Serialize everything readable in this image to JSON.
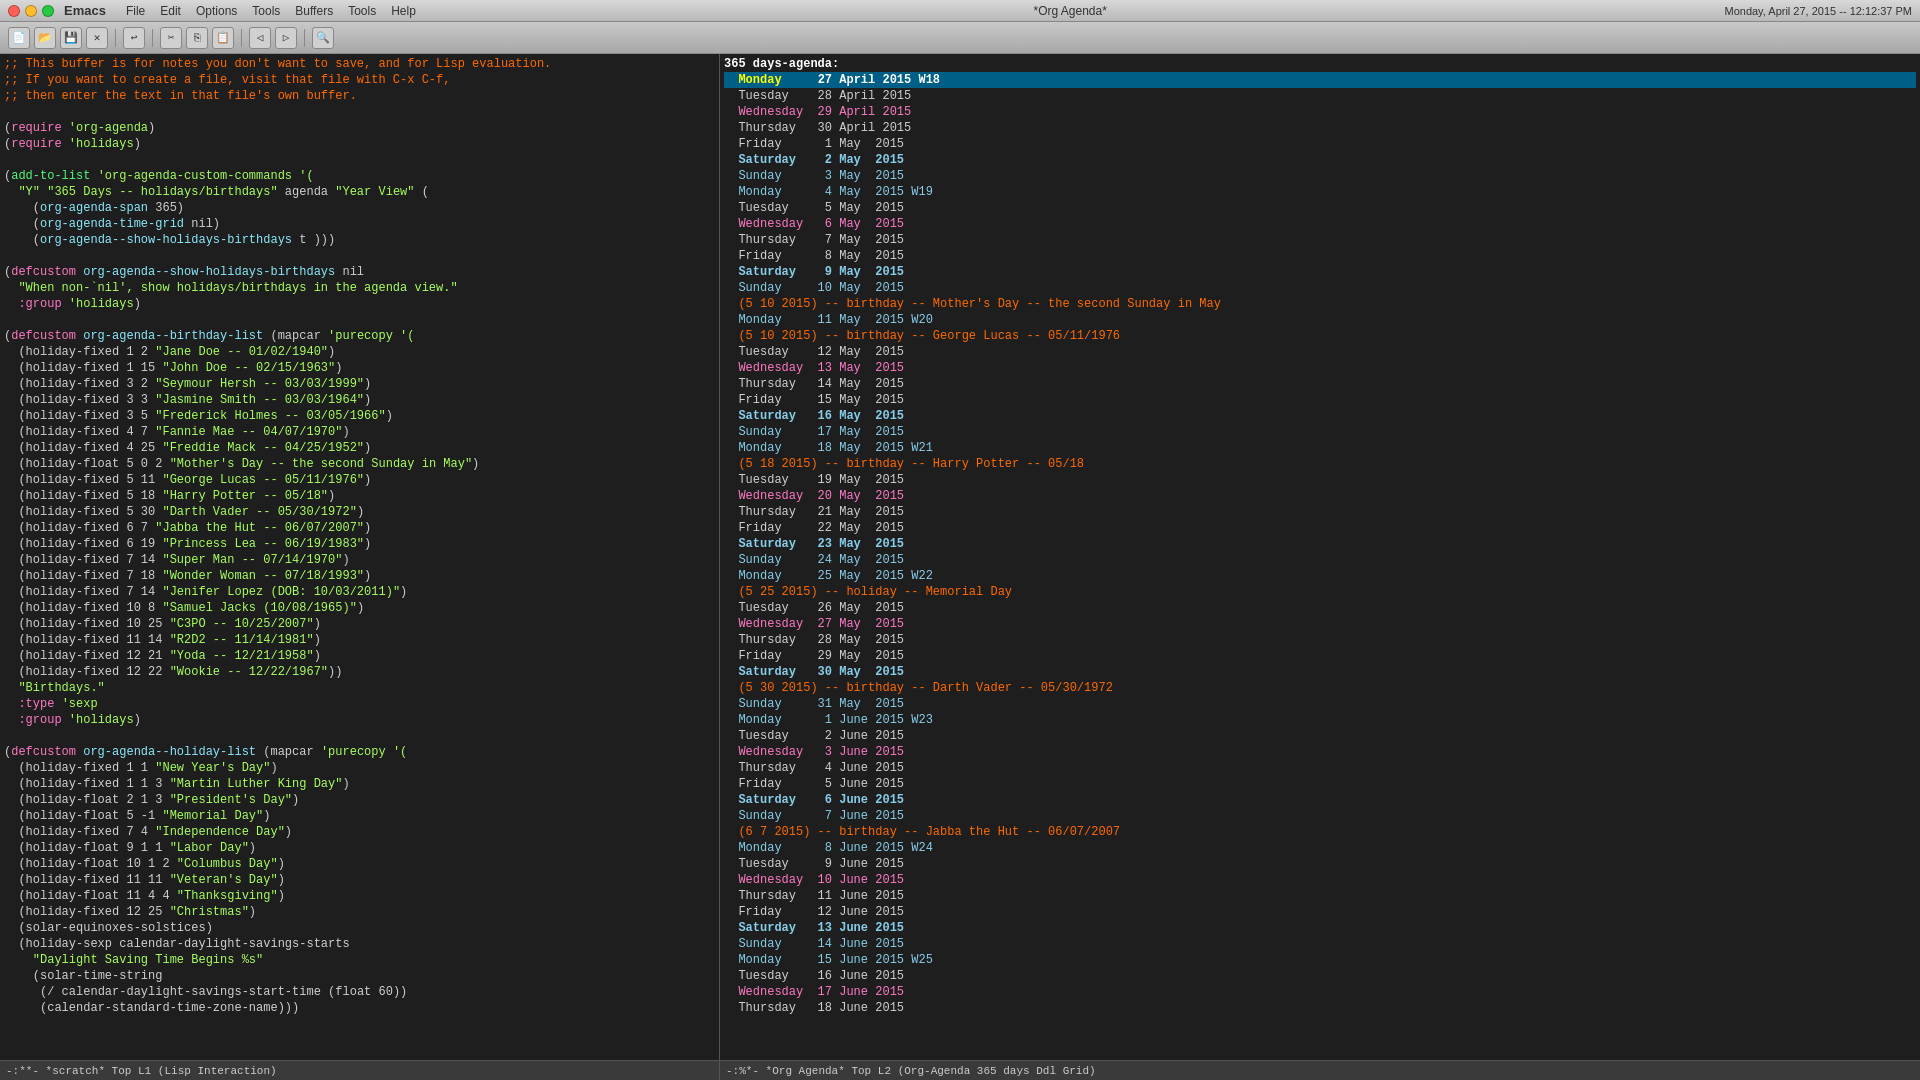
{
  "titlebar": {
    "app": "Emacs",
    "menus": [
      "File",
      "Edit",
      "Options",
      "Tools",
      "Buffers",
      "Tools",
      "Help"
    ],
    "center_title": "*Org Agenda*",
    "right_info": "Monday, April 27, 2015 -- 12:12:37 PM"
  },
  "left_panel": {
    "title": "*scratch*",
    "status": "-:**-  *scratch*      Top L1     (Lisp Interaction)"
  },
  "right_panel": {
    "title": "*Org Agenda*",
    "status": "-:%*-  *Org Agenda*   Top L2     (Org-Agenda 365 days Ddl Grid)"
  },
  "agenda_header": "365 days-agenda:",
  "colors": {
    "bg": "#1e1e1e",
    "today_bg": "#005f87",
    "comment": "#ff6a00",
    "string": "#a8ff60",
    "keyword": "#ff79c6",
    "function": "#8be9fd",
    "event": "#ff6a00"
  }
}
